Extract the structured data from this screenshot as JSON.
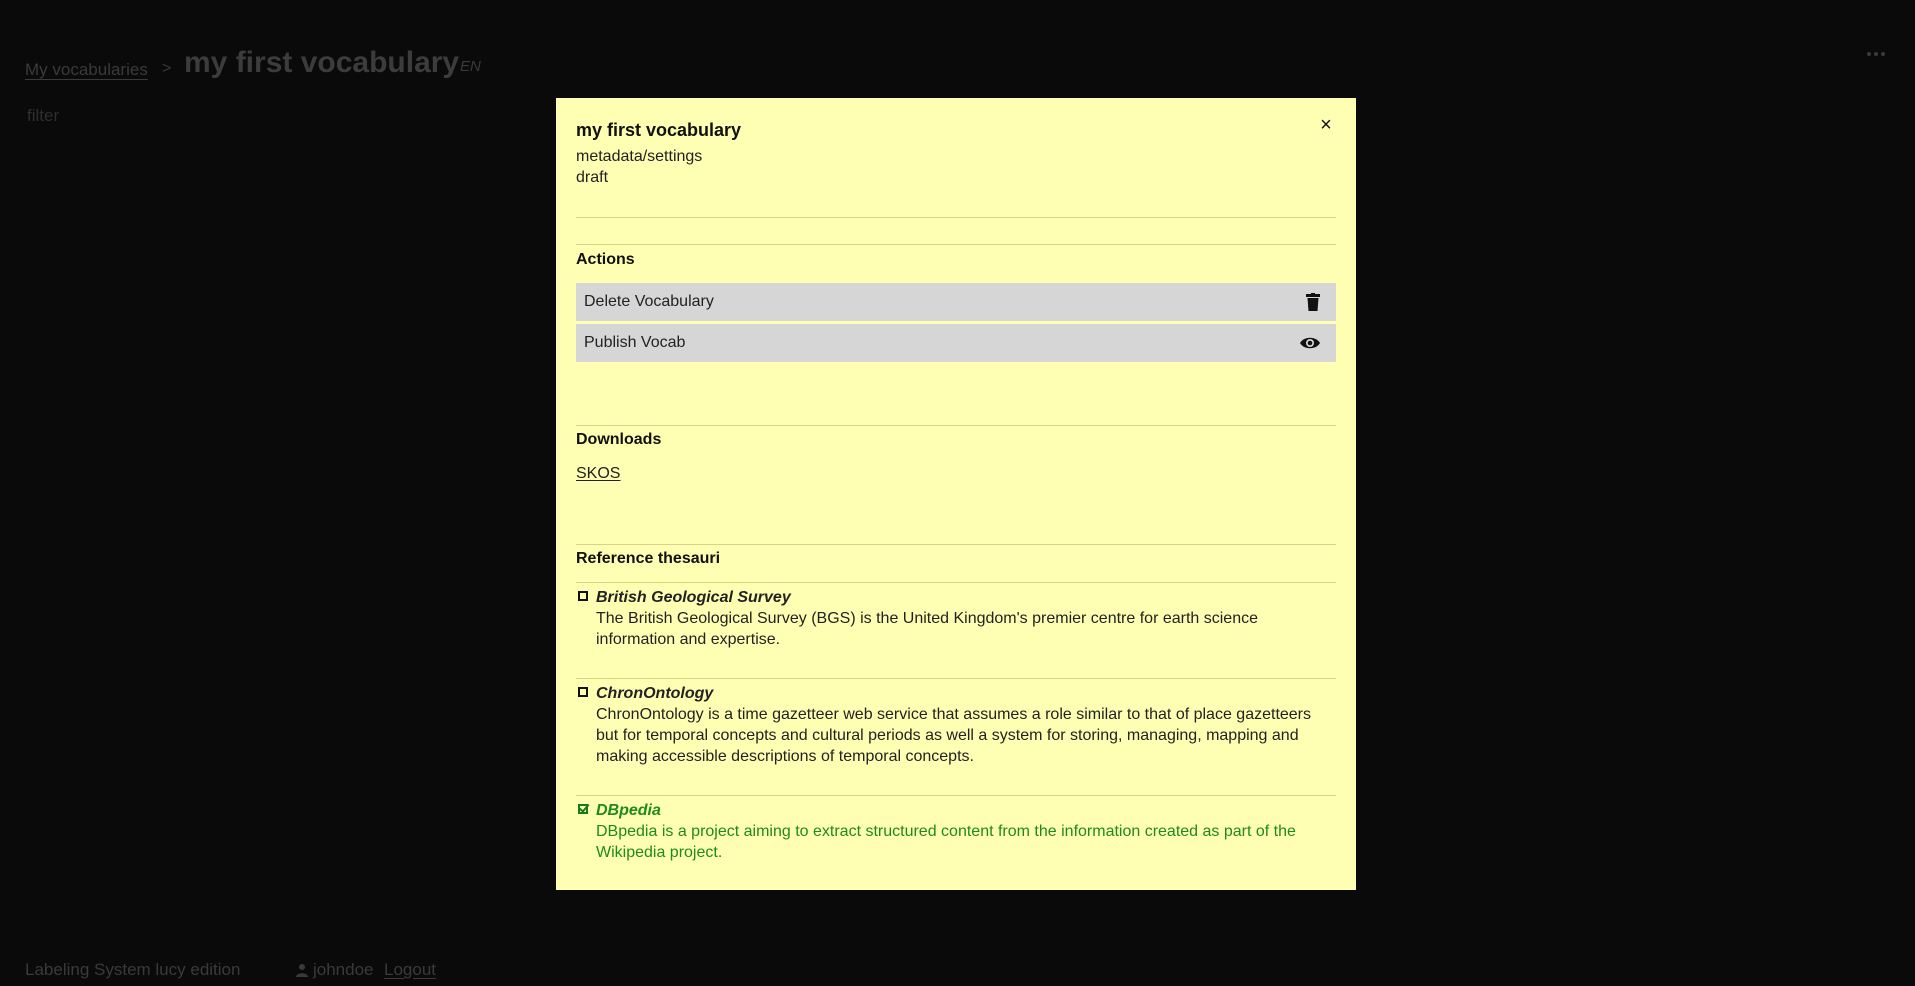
{
  "header": {
    "breadcrumb": "My vocabularies",
    "separator": ">",
    "title": "my first vocabulary",
    "lang": "EN"
  },
  "filter": {
    "placeholder": "filter",
    "value": ""
  },
  "footer": {
    "app_name": "Labeling System lucy edition",
    "username": "johndoe",
    "logout": "Logout"
  },
  "modal": {
    "title": "my first vocabulary",
    "close_symbol": "×",
    "subtitle": "metadata/settings",
    "status": "draft",
    "actions_title": "Actions",
    "actions": [
      {
        "label": "Delete Vocabulary",
        "icon": "trash-icon"
      },
      {
        "label": "Publish Vocab",
        "icon": "eye-icon"
      }
    ],
    "downloads_title": "Downloads",
    "downloads": [
      {
        "label": "SKOS"
      }
    ],
    "thesauri_title": "Reference thesauri",
    "thesauri": [
      {
        "name": "British Geological Survey",
        "description": "The British Geological Survey (BGS) is the United Kingdom's premier centre for earth science information and expertise.",
        "selected": false
      },
      {
        "name": "ChronOntology",
        "description": "ChronOntology is a time gazetteer web service that assumes a role similar to that of place gazetteers but for temporal concepts and cultural periods as well a system for storing, managing, mapping and making accessible descriptions of temporal concepts.",
        "selected": false
      },
      {
        "name": "DBpedia",
        "description": "DBpedia is a project aiming to extract structured content from the information created as part of the Wikipedia project.",
        "selected": true
      }
    ]
  },
  "colors": {
    "modal_background": "#ffffb3",
    "button_background": "#d6d6d6",
    "selected_text": "#1f8a1f",
    "page_background": "#0a0a0a"
  }
}
